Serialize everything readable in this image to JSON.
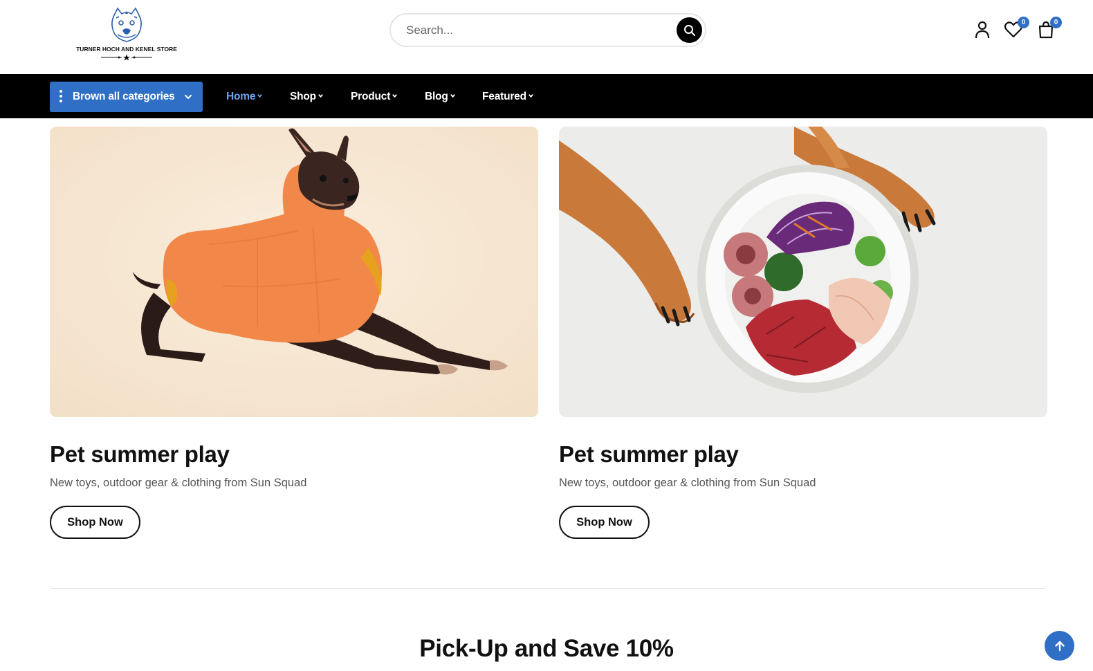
{
  "header": {
    "logo_text": "TURNER HOCH AND KENEL STORE",
    "search_placeholder": "Search...",
    "wishlist_count": "0",
    "cart_count": "0",
    "icons": [
      "search-icon",
      "user-icon",
      "heart-icon",
      "shopping-bag-icon"
    ]
  },
  "nav": {
    "categories_label": "Brown all categories",
    "items": [
      {
        "label": "Home",
        "active": true
      },
      {
        "label": "Shop"
      },
      {
        "label": "Product"
      },
      {
        "label": "Blog"
      },
      {
        "label": "Featured"
      }
    ]
  },
  "banners": [
    {
      "image": "dog-in-orange-jacket",
      "title": "Pet summer play",
      "subtitle": "New toys, outdoor gear & clothing from Sun Squad",
      "button": "Shop Now"
    },
    {
      "image": "dog-paws-with-food-bowl",
      "title": "Pet summer play",
      "subtitle": "New toys, outdoor gear & clothing from Sun Squad",
      "button": "Shop Now"
    }
  ],
  "section": {
    "title": "Pick-Up and Save 10%"
  },
  "colors": {
    "accent": "#2f6fc6",
    "nav_bg": "#000000",
    "active_link": "#6fa2e8"
  }
}
